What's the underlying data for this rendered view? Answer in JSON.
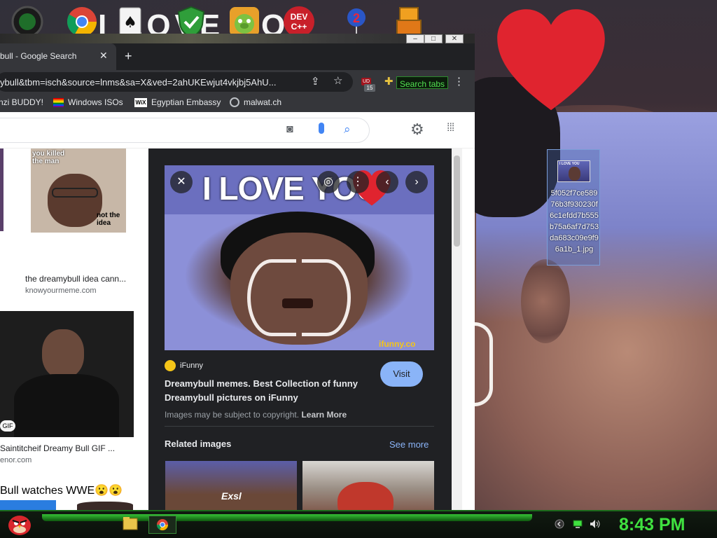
{
  "desktop": {
    "wallpaper_banner": "I LOVE YOU",
    "file_icon": {
      "name": "5f052f7ce58976b3f930230f6c1efdd7b555b75a6af7d753da683c09e9f96a1b_1.jpg",
      "thumb_text": "I LOVE YOU"
    },
    "top_icons": [
      "app-icon",
      "chrome-icon",
      "solitaire-icon",
      "shield-icon",
      "bad-piggies-icon",
      "dev-cpp-icon",
      "balloon-icon",
      "game-icon"
    ],
    "dev_icon_text": "DEV C++"
  },
  "browser": {
    "tab": {
      "title": "bull - Google Search",
      "close": "✕"
    },
    "new_tab": "+",
    "url": "ybull&tbm=isch&source=lnms&sa=X&ved=2ahUKEwjut4vkjbj5AhU...",
    "extension_badges": {
      "top": "UD",
      "count": "15"
    },
    "search_tabs": "Search tabs",
    "bookmarks": [
      {
        "label": "nzi BUDDY!"
      },
      {
        "label": "Windows ISOs"
      },
      {
        "label": "Egyptian Embassy"
      },
      {
        "label": "malwat.ch"
      }
    ],
    "wix_text": "WiX"
  },
  "results": [
    {
      "caption": "the dreamybull idea cann...",
      "source": "knowyourmeme.com",
      "overlay_top": "you killed the man",
      "overlay_bottom": "not the idea"
    },
    {
      "caption": "Saintitcheif Dreamy Bull GIF ...",
      "source": "enor.com",
      "badge": "GIF"
    },
    {
      "caption": "Bull watches WWE😮😮",
      "source": ""
    }
  ],
  "preview": {
    "image_text": "I LOVE YOU",
    "watermark": "ifunny.co",
    "source_name": "iFunny",
    "title": "Dreamybull memes. Best Collection of funny Dreamybull pictures on iFunny",
    "visit": "Visit",
    "copyright": "Images may be subject to copyright.",
    "learn_more": "Learn More",
    "related_heading": "Related images",
    "see_more": "See more",
    "related_overlay": "Exsl"
  },
  "taskbar": {
    "clock": "8:43 PM"
  },
  "colors": {
    "accent_blue": "#8ab4f8",
    "clock_green": "#3fe13f",
    "heart_red": "#e0242f"
  }
}
